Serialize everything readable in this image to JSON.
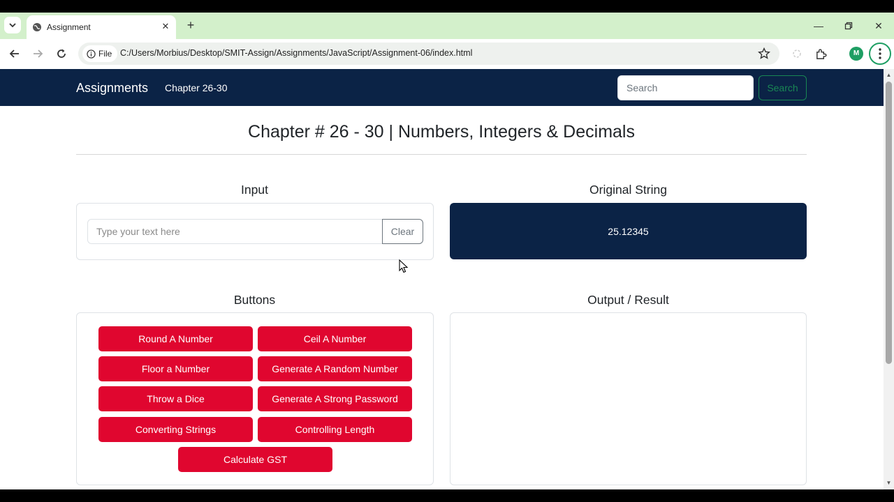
{
  "browser": {
    "tab_title": "Assignment",
    "file_chip": "File",
    "url": "C:/Users/Morbius/Desktop/SMIT-Assign/Assignments/JavaScript/Assignment-06/index.html",
    "avatar_letter": "M",
    "accent": "#1e9e63",
    "tabstrip_color": "#d3f0cb"
  },
  "navbar": {
    "brand": "Assignments",
    "link": "Chapter 26-30",
    "search_placeholder": "Search",
    "search_button": "Search",
    "bg": "#0b2346"
  },
  "page": {
    "title": "Chapter # 26 - 30 | Numbers, Integers & Decimals"
  },
  "input_section": {
    "title": "Input",
    "placeholder": "Type your text here",
    "value": "",
    "clear_label": "Clear"
  },
  "original_section": {
    "title": "Original String",
    "value": "25.12345"
  },
  "buttons_section": {
    "title": "Buttons",
    "button_color": "#e0062f",
    "items": [
      {
        "label": "Round A Number"
      },
      {
        "label": "Ceil A Number"
      },
      {
        "label": "Floor a Number"
      },
      {
        "label": "Generate A Random Number"
      },
      {
        "label": "Throw a Dice"
      },
      {
        "label": "Generate A Strong Password"
      },
      {
        "label": "Converting Strings"
      },
      {
        "label": "Controlling Length"
      },
      {
        "label": "Calculate GST"
      }
    ]
  },
  "output_section": {
    "title": "Output / Result",
    "value": ""
  }
}
